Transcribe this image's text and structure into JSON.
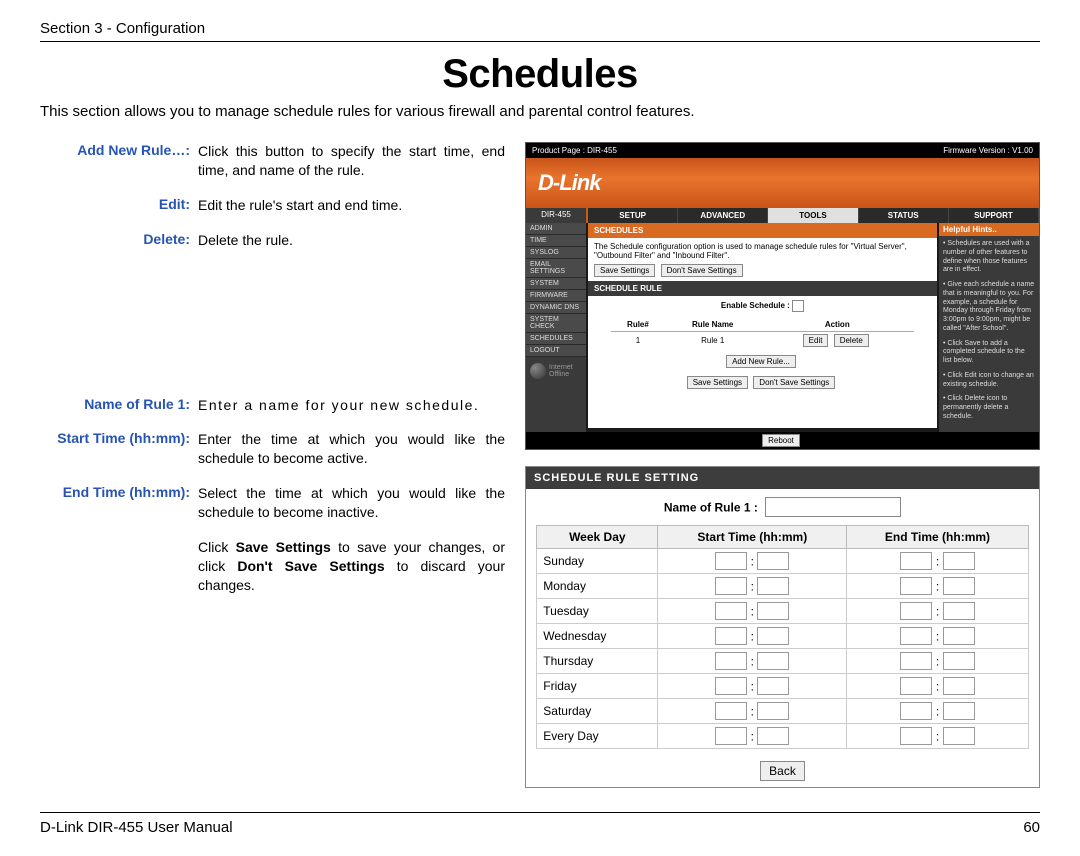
{
  "header": {
    "section": "Section 3 - Configuration"
  },
  "title": "Schedules",
  "intro": "This section allows you to manage schedule rules for various firewall and parental control features.",
  "defs": {
    "add_new_rule": {
      "term": "Add New Rule…:",
      "desc": "Click this button to specify the start time, end time, and name of the rule."
    },
    "edit": {
      "term": "Edit:",
      "desc": "Edit the rule's start and end time."
    },
    "delete": {
      "term": "Delete:",
      "desc": "Delete the rule."
    },
    "name_of_rule": {
      "term": "Name of Rule 1:",
      "desc": "Enter a name for your new schedule."
    },
    "start_time": {
      "term": "Start Time (hh:mm):",
      "desc": "Enter the time at which you would like the schedule to become active."
    },
    "end_time": {
      "term": "End Time (hh:mm):",
      "desc": "Select the time at which you would like the schedule to become inactive."
    }
  },
  "save_note": {
    "pre": "Click ",
    "b1": "Save Settings",
    "mid": " to save your changes, or click ",
    "b2": "Don't Save Settings",
    "post": " to discard your changes."
  },
  "router": {
    "product_page": "Product Page : DIR-455",
    "firmware": "Firmware Version : V1.00",
    "logo": "D-Link",
    "model": "DIR-455",
    "tabs": {
      "setup": "SETUP",
      "advanced": "ADVANCED",
      "tools": "TOOLS",
      "status": "STATUS",
      "support": "SUPPORT"
    },
    "side": [
      "ADMIN",
      "TIME",
      "SYSLOG",
      "EMAIL SETTINGS",
      "SYSTEM",
      "FIRMWARE",
      "DYNAMIC DNS",
      "SYSTEM CHECK",
      "SCHEDULES",
      "LOGOUT"
    ],
    "internet": "Internet Offline",
    "sched_hdr": "SCHEDULES",
    "sched_text": "The Schedule configuration option is used to manage schedule rules for \"Virtual Server\", \"Outbound Filter\" and \"Inbound Filter\".",
    "btn_save": "Save Settings",
    "btn_dont": "Don't Save Settings",
    "rule_hdr": "SCHEDULE RULE",
    "enable_label": "Enable Schedule :",
    "tbl": {
      "h1": "Rule#",
      "h2": "Rule Name",
      "h3": "Action",
      "r1": "1",
      "r2": "Rule 1",
      "edit": "Edit",
      "delete": "Delete"
    },
    "add_new": "Add New Rule...",
    "reboot": "Reboot",
    "help_hdr": "Helpful Hints..",
    "hints": [
      "• Schedules are used with a number of other features to define when those features are in effect.",
      "• Give each schedule a name that is meaningful to you. For example, a schedule for Monday through Friday from 3:00pm to 9:00pm, might be called \"After School\".",
      "• Click Save to add a completed schedule to the list below.",
      "• Click Edit icon to change an existing schedule.",
      "• Click Delete icon to permanently delete a schedule."
    ]
  },
  "sched_setting": {
    "hdr": "SCHEDULE RULE SETTING",
    "name_label": "Name of Rule 1 :",
    "cols": {
      "day": "Week Day",
      "start": "Start Time (hh:mm)",
      "end": "End Time (hh:mm)"
    },
    "days": [
      "Sunday",
      "Monday",
      "Tuesday",
      "Wednesday",
      "Thursday",
      "Friday",
      "Saturday",
      "Every Day"
    ],
    "back": "Back"
  },
  "footer": {
    "left": "D-Link DIR-455 User Manual",
    "page": "60"
  }
}
